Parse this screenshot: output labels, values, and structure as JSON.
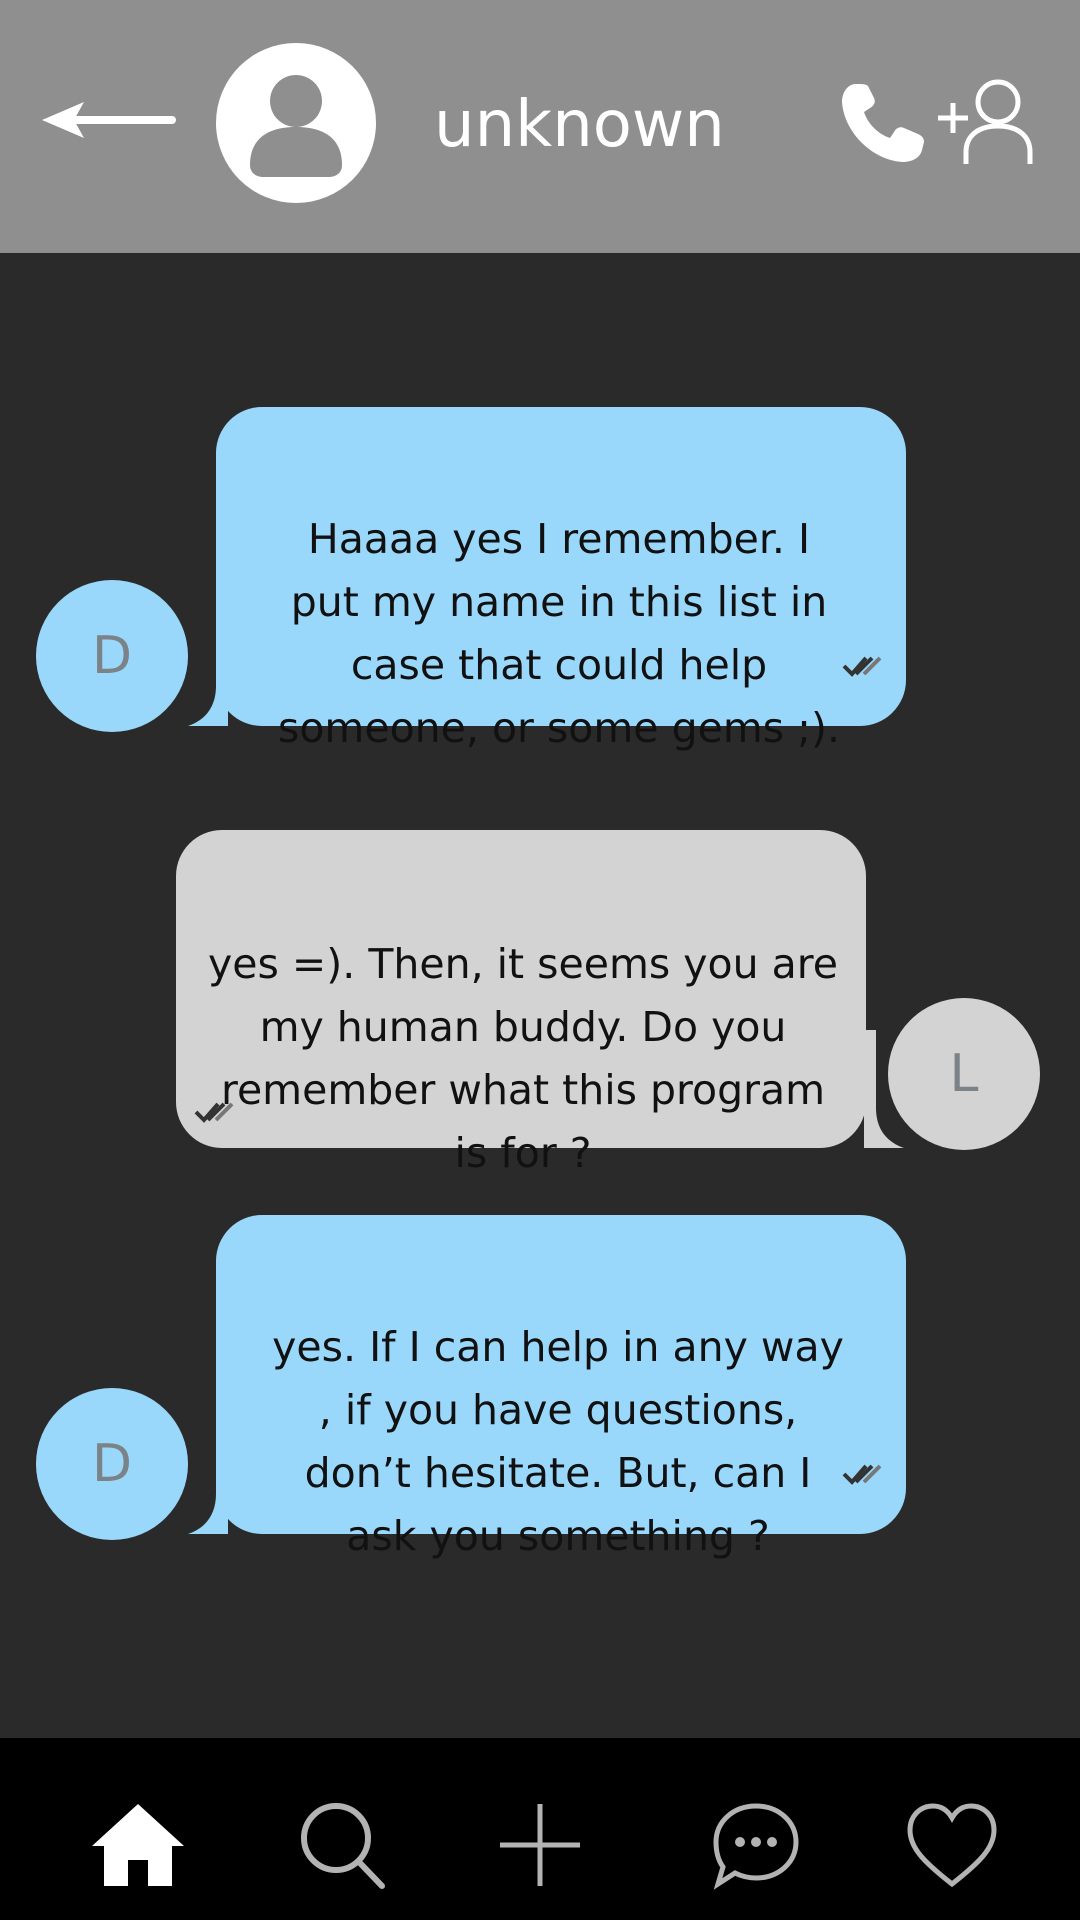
{
  "header": {
    "title": "unknown",
    "icons": [
      "back-arrow-icon",
      "user-avatar-icon",
      "phone-icon",
      "add-contact-icon"
    ]
  },
  "messages": [
    {
      "sender_initial": "D",
      "side": "left",
      "color": "#9ad8fb",
      "text": "Haaaa yes I remember. I\nput my name in this list in\ncase that could help\nsomeone, or some gems ;).",
      "status_icon": "double-check-icon"
    },
    {
      "sender_initial": "L",
      "side": "right",
      "color": "#d3d3d3",
      "text": "yes =). Then, it seems you are\nmy human buddy. Do you\nremember what this program\nis for ?",
      "status_icon": "double-check-icon"
    },
    {
      "sender_initial": "D",
      "side": "left",
      "color": "#9ad8fb",
      "text": "yes. If I can help in any way\n, if you have questions,\ndon’t hesitate. But, can I\nask you something ?",
      "status_icon": "double-check-icon"
    }
  ],
  "nav": {
    "items": [
      "home-icon",
      "search-icon",
      "plus-icon",
      "chat-icon",
      "heart-icon"
    ],
    "active": "home-icon"
  },
  "colors": {
    "header_bg": "#8f8f8f",
    "chat_bg": "#2a2a2a",
    "bubble_sent": "#9ad8fb",
    "bubble_received": "#d3d3d3",
    "nav_bg": "#000000"
  }
}
